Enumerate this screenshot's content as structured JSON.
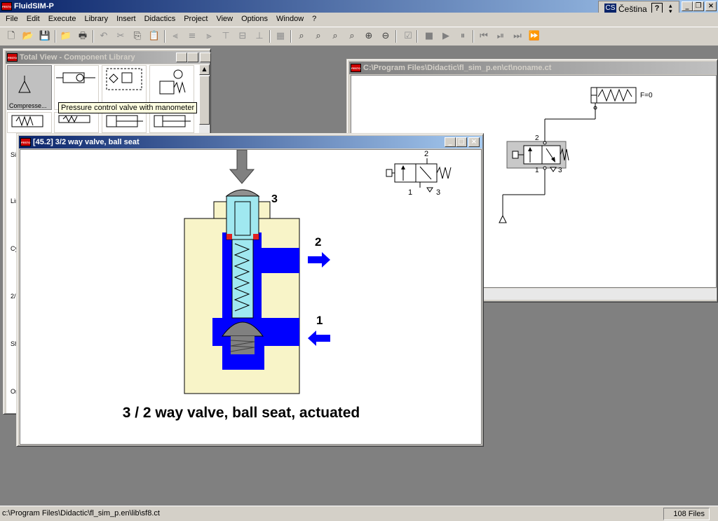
{
  "app": {
    "title": "FluidSIM-P"
  },
  "lang": {
    "code": "CS",
    "label": "Čeština",
    "help": "?"
  },
  "menu": [
    "File",
    "Edit",
    "Execute",
    "Library",
    "Insert",
    "Didactics",
    "Project",
    "View",
    "Options",
    "Window",
    "?"
  ],
  "library_window": {
    "title": "Total View - Component Library",
    "first_item_label": "Compresse...",
    "tooltip": "Pressure control valve with manometer",
    "side_labels": [
      "Si",
      "Lin",
      "Cy",
      "2/",
      "Sh",
      "Or"
    ]
  },
  "circuit_window": {
    "title": "C:\\Program Files\\Didactic\\fl_sim_p.en\\ct\\noname.ct",
    "cylinder_label": "F=0",
    "port_2": "2",
    "port_1": "1",
    "port_3": "3"
  },
  "didactic_window": {
    "title": "[45.2] 3/2 way valve, ball seat",
    "caption": "3 / 2 way valve, ball seat, actuated",
    "label_3": "3",
    "label_2": "2",
    "label_1": "1",
    "symbol_2": "2",
    "symbol_1": "1",
    "symbol_3": "3"
  },
  "statusbar": {
    "path": "c:\\Program Files\\Didactic\\fl_sim_p.en\\lib\\sf8.ct",
    "files": "108 Files"
  },
  "colors": {
    "title_active": "#0a246a",
    "valve_blue": "#0000ff",
    "body_cream": "#f8f4c8",
    "spring_cyan": "#a0e8f0",
    "ports_red": "#e02020"
  }
}
